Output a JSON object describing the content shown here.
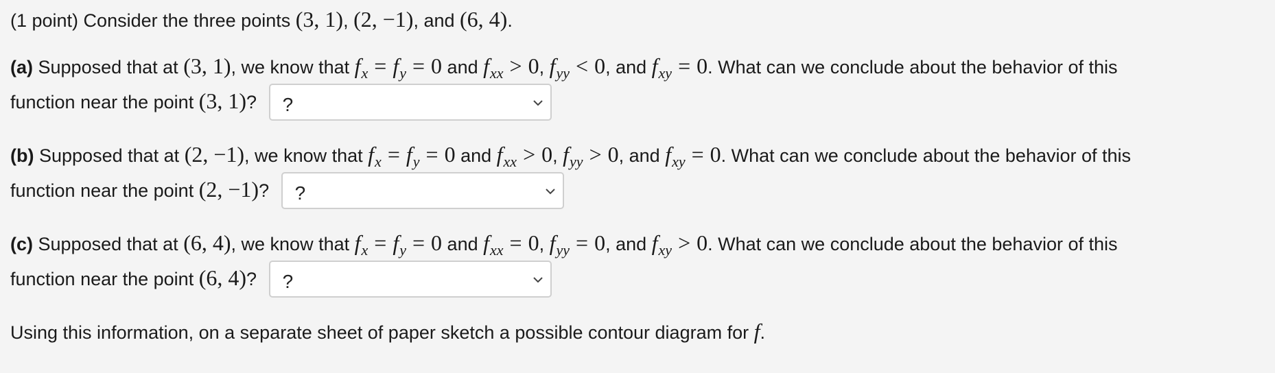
{
  "intro": {
    "prefix": "(1 point) Consider the three points",
    "p1": "(3, 1)",
    "p2": "(2, −1)",
    "conj": ", and",
    "p3": "(6, 4)",
    "end": "."
  },
  "parts": [
    {
      "label": "(a)",
      "point": "(3, 1)",
      "fxx_rel": ">",
      "fyy_rel": "<",
      "fxy_rel": "=",
      "select_value": "?"
    },
    {
      "label": "(b)",
      "point": "(2, −1)",
      "fxx_rel": ">",
      "fyy_rel": ">",
      "fxy_rel": "=",
      "select_value": "?"
    },
    {
      "label": "(c)",
      "point": "(6, 4)",
      "fxx_rel": "=",
      "fyy_rel": "=",
      "fxy_rel": ">",
      "select_value": "?"
    }
  ],
  "text": {
    "supposed": "Supposed that at",
    "we_know": ", we know that",
    "and": "and",
    "comma_and": ", and",
    "question": ". What can we conclude about the behavior of this",
    "near": "function near the point",
    "qmark": "?",
    "zero": "0",
    "f": "f",
    "x": "x",
    "y": "y",
    "xx": "xx",
    "yy": "yy",
    "xy": "xy",
    "eq": "="
  },
  "closing": {
    "text": "Using this information, on a separate sheet of paper sketch a possible contour diagram for",
    "f": "f",
    "end": "."
  }
}
